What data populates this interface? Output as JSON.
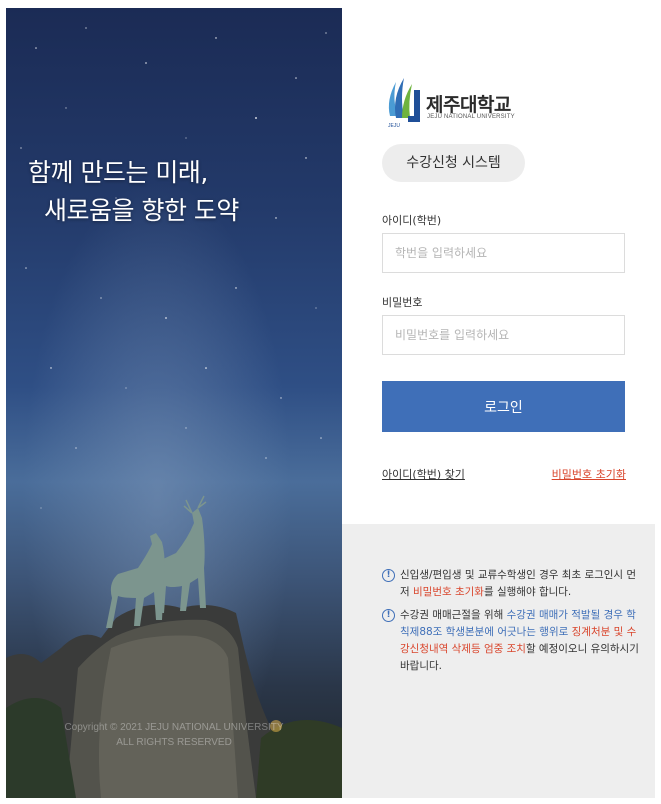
{
  "hero": {
    "title_line1": "함께 만드는 미래,",
    "title_line2": "새로움을 향한 도약",
    "copyright_line1": "Copyright © 2021 JEJU NATIONAL UNIVERSITY",
    "copyright_line2": "ALL RIGHTS RESERVED"
  },
  "logo": {
    "name": "제주대학교",
    "subtitle": "JEJU NATIONAL UNIVERSITY",
    "emblem_text": "JEJU",
    "emblem_icon": "university-emblem-icon"
  },
  "system_badge": "수강신청 시스템",
  "form": {
    "id_label": "아이디(학번)",
    "id_placeholder": "학번을 입력하세요",
    "id_value": "",
    "password_label": "비밀번호",
    "password_placeholder": "비밀번호를 입력하세요",
    "password_value": "",
    "login_button": "로그인"
  },
  "links": {
    "find_id": "아이디(학번) 찾기",
    "reset_password": "비밀번호 초기화"
  },
  "notices": [
    {
      "icon": "!",
      "p1": "신입생/편입생 및 교류수학생인 경우 최초 로그인시 먼저 ",
      "p2": "비밀번호 초기화",
      "p3": "를 실행해야 합니다."
    },
    {
      "icon": "!",
      "p1": "수강권 매매근절을 위해 ",
      "p2": "수강권 매매가 적발될 경우 학칙제88조 학생본분에 어긋나는 행위로 ",
      "p3": "징계처분 및 수강신청내역 삭제등 엄중 조치",
      "p4": "할 예정이오니 유의하시기 바랍니다."
    }
  ],
  "colors": {
    "primary": "#3f6fb8",
    "accent_red": "#d9452c",
    "notice_bg": "#eeeeee"
  }
}
